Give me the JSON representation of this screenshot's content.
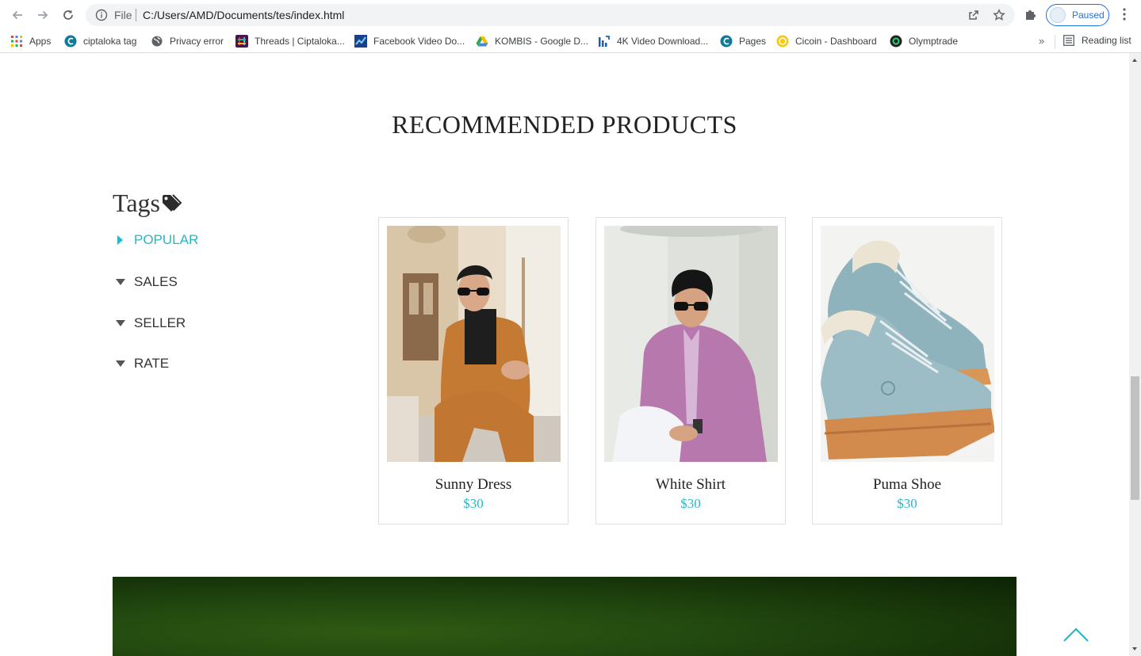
{
  "browser": {
    "omnibox_scheme": "File",
    "url": "C:/Users/AMD/Documents/tes/index.html",
    "profile_label": "Paused",
    "bookmarks": [
      {
        "label": "Apps",
        "icon": "apps-grid-icon"
      },
      {
        "label": "ciptaloka tag",
        "icon": "ciptaloka-icon"
      },
      {
        "label": "Privacy error",
        "icon": "globe-icon"
      },
      {
        "label": "Threads | Ciptaloka...",
        "icon": "slack-icon"
      },
      {
        "label": "Facebook Video Do...",
        "icon": "chart-icon"
      },
      {
        "label": "KOMBIS - Google D...",
        "icon": "drive-icon"
      },
      {
        "label": "4K Video Download...",
        "icon": "bars-icon"
      },
      {
        "label": "Pages",
        "icon": "ciptaloka-icon"
      },
      {
        "label": "Cicoin - Dashboard",
        "icon": "coin-icon"
      },
      {
        "label": "Olymptrade",
        "icon": "olymptrade-icon"
      }
    ],
    "more_label": "»",
    "reading_list_label": "Reading list"
  },
  "page": {
    "section_title": "RECOMMENDED PRODUCTS",
    "tags_title": "Tags",
    "accent_color": "#29b6c8",
    "tags": [
      {
        "label": "POPULAR",
        "state": "collapsed-active"
      },
      {
        "label": "SALES",
        "state": "expanded"
      },
      {
        "label": "SELLER",
        "state": "expanded"
      },
      {
        "label": "RATE",
        "state": "expanded"
      }
    ],
    "products": [
      {
        "name": "Sunny Dress",
        "price": "$30",
        "image": "man-in-orange-suit-photo"
      },
      {
        "name": "White Shirt",
        "price": "$30",
        "image": "man-in-pink-shirt-photo"
      },
      {
        "name": "Puma Shoe",
        "price": "$30",
        "image": "blue-boots-photo"
      }
    ]
  }
}
